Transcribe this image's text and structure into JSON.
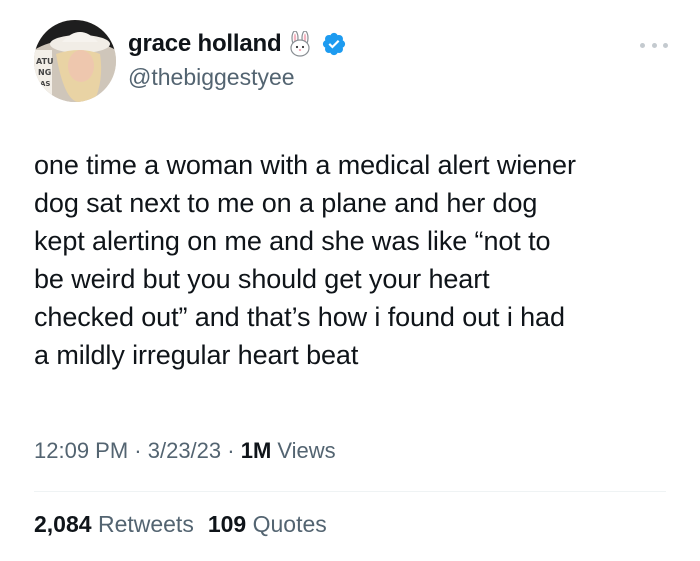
{
  "author": {
    "display_name": "grace holland",
    "name_emoji": "rabbit-face-emoji",
    "verified": true,
    "handle": "@thebiggestyee"
  },
  "tweet": {
    "text_lines": [
      "one time a woman with a medical alert wiener",
      "dog sat next to me on a plane and her dog",
      "kept alerting on me and she was like “not to",
      "be weird but you should get your heart",
      "checked out” and that’s how i found out i had",
      "a mildly irregular heart beat"
    ]
  },
  "meta": {
    "time": "12:09 PM",
    "sep1": " · ",
    "date": "3/23/23",
    "sep2": " · ",
    "views_count": "1M",
    "views_label": " Views"
  },
  "stats": {
    "retweets_count": "2,084",
    "retweets_label": " Retweets",
    "quotes_count": "109",
    "quotes_label": " Quotes"
  },
  "colors": {
    "text_primary": "#0f1419",
    "text_secondary": "#536471",
    "verified_blue": "#1d9bf0",
    "divider": "#eff3f4"
  }
}
